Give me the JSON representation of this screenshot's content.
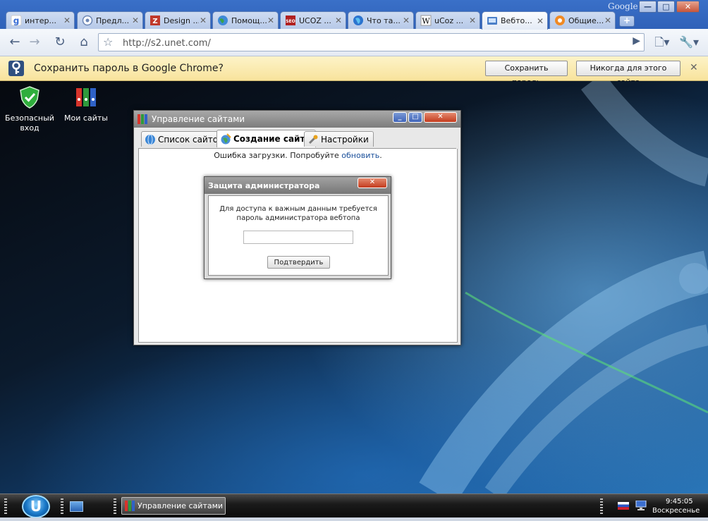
{
  "browser": {
    "brand": "Google",
    "tabs": [
      {
        "label": "интер...",
        "icon": "google-icon"
      },
      {
        "label": "Предл...",
        "icon": "site-icon"
      },
      {
        "label": "Design ...",
        "icon": "design-icon"
      },
      {
        "label": "Помощ...",
        "icon": "globe-icon"
      },
      {
        "label": "UCOZ ...",
        "icon": "seo-icon"
      },
      {
        "label": "Что та...",
        "icon": "globe-icon"
      },
      {
        "label": "uCoz ...",
        "icon": "wikipedia-icon"
      },
      {
        "label": "Вебто...",
        "icon": "webtop-icon"
      },
      {
        "label": "Общие...",
        "icon": "site-icon"
      }
    ],
    "active_tab": 7,
    "url": "http://s2.unet.com/"
  },
  "infobar": {
    "message": "Сохранить пароль в Google Chrome?",
    "save_label": "Сохранить пароль",
    "never_label": "Никогда для этого сайта"
  },
  "desktop": {
    "icons": [
      {
        "label": "Безопасный вход",
        "icon": "shield-icon"
      },
      {
        "label": "Мои сайты",
        "icon": "binders-icon"
      }
    ]
  },
  "sites_window": {
    "title": "Управление сайтами",
    "tabs": [
      {
        "label": "Список сайтов"
      },
      {
        "label": "Создание сайта"
      },
      {
        "label": "Настройки"
      }
    ],
    "active_tab": 1,
    "error_text": "Ошибка загрузки. Попробуйте",
    "retry_link": "обновить",
    "error_suffix": "."
  },
  "admin_dialog": {
    "title": "Защита администратора",
    "message": "Для доступа к важным данным требуется пароль администратора вебтопа",
    "password_value": "",
    "confirm_label": "Подтвердить"
  },
  "taskbar": {
    "start_glyph": "U",
    "task_label": "Управление сайтами",
    "time": "9:45:05",
    "day": "Воскресенье"
  },
  "colors": {
    "tabstrip": "#3a70c8",
    "infobar": "#f8e39c",
    "link": "#1a4f9a"
  }
}
